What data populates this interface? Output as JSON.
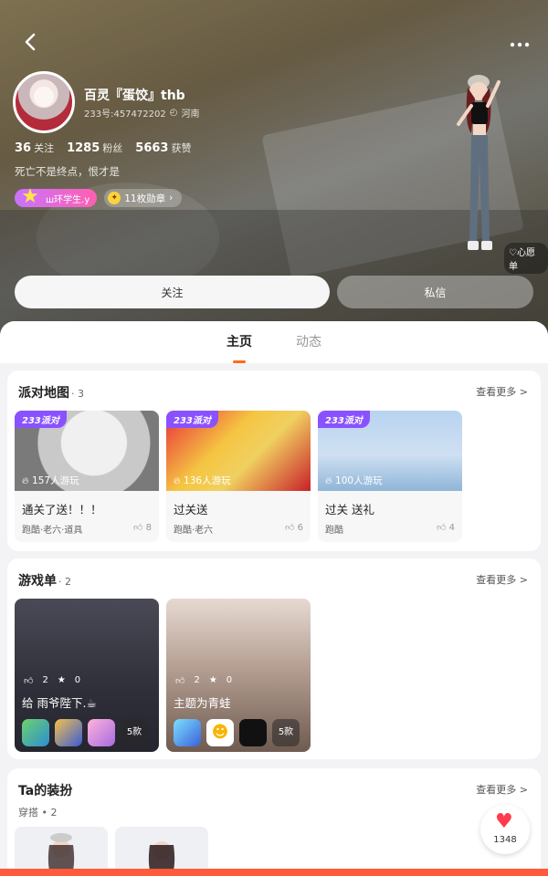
{
  "header": {
    "back_icon": "chevron-left-icon",
    "more_icon": "more-dots-icon",
    "username": "百灵『蛋饺』thb",
    "uid_text": "233号:457472202",
    "location": "河南",
    "stats": [
      {
        "value": "36",
        "label": "关注"
      },
      {
        "value": "1285",
        "label": "粉丝"
      },
      {
        "value": "5663",
        "label": "获赞"
      }
    ],
    "bio": "死亡不是终点，恨才是",
    "title_badge": "ш环学生.y",
    "medals": "11枚勋章",
    "wishlist": "心愿单",
    "follow_label": "关注",
    "message_label": "私信"
  },
  "tabs": [
    {
      "label": "主页",
      "active": true
    },
    {
      "label": "动态",
      "active": false
    }
  ],
  "party_map": {
    "title": "派对地图",
    "count": "· 3",
    "see_more": "查看更多 >",
    "items": [
      {
        "tag": "233派对",
        "plays": "157人游玩",
        "title": "通关了送！！！",
        "tags": "跑酷·老六·道具",
        "likes": "8"
      },
      {
        "tag": "233派对",
        "plays": "136人游玩",
        "title": "过关送",
        "tags": "跑酷·老六",
        "likes": "6"
      },
      {
        "tag": "233派对",
        "plays": "100人游玩",
        "title": "过关   送礼",
        "tags": "跑酷",
        "likes": "4"
      }
    ]
  },
  "game_list": {
    "title": "游戏单",
    "count": "· 2",
    "see_more": "查看更多 >",
    "items": [
      {
        "likes": "2",
        "stars": "0",
        "title": "给  雨爷陛下.☕",
        "more": "5款"
      },
      {
        "likes": "2",
        "stars": "0",
        "title": "主题为青蛙",
        "more": "5款"
      }
    ]
  },
  "ta_outfit": {
    "title": "Ta的装扮",
    "see_more": "查看更多 >",
    "sub": "穿搭 • 2"
  },
  "like_fab": {
    "count": "1348"
  },
  "colors": {
    "accent": "#ff6a1a",
    "party_tag": "#8a52ff",
    "like": "#ff3b4e"
  }
}
